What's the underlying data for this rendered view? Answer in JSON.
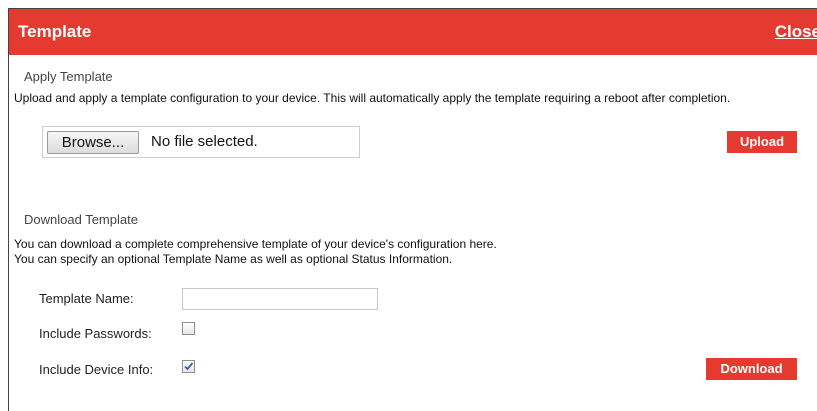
{
  "dialog": {
    "title": "Template",
    "close_label": "Close"
  },
  "apply": {
    "heading": "Apply Template",
    "description": "Upload and apply a template configuration to your device. This will automatically apply the template requiring a reboot after completion.",
    "browse_label": "Browse...",
    "file_status": "No file selected.",
    "upload_label": "Upload"
  },
  "download": {
    "heading": "Download Template",
    "description_line1": "You can download a complete comprehensive template of your device's configuration here.",
    "description_line2": "You can specify an optional Template Name as well as optional Status Information.",
    "template_name_label": "Template Name:",
    "template_name_value": "",
    "include_passwords_label": "Include Passwords:",
    "include_passwords_checked": false,
    "include_device_info_label": "Include Device Info:",
    "include_device_info_checked": true,
    "download_label": "Download"
  },
  "colors": {
    "accent": "#e53a30",
    "title_text": "#ffffff"
  }
}
